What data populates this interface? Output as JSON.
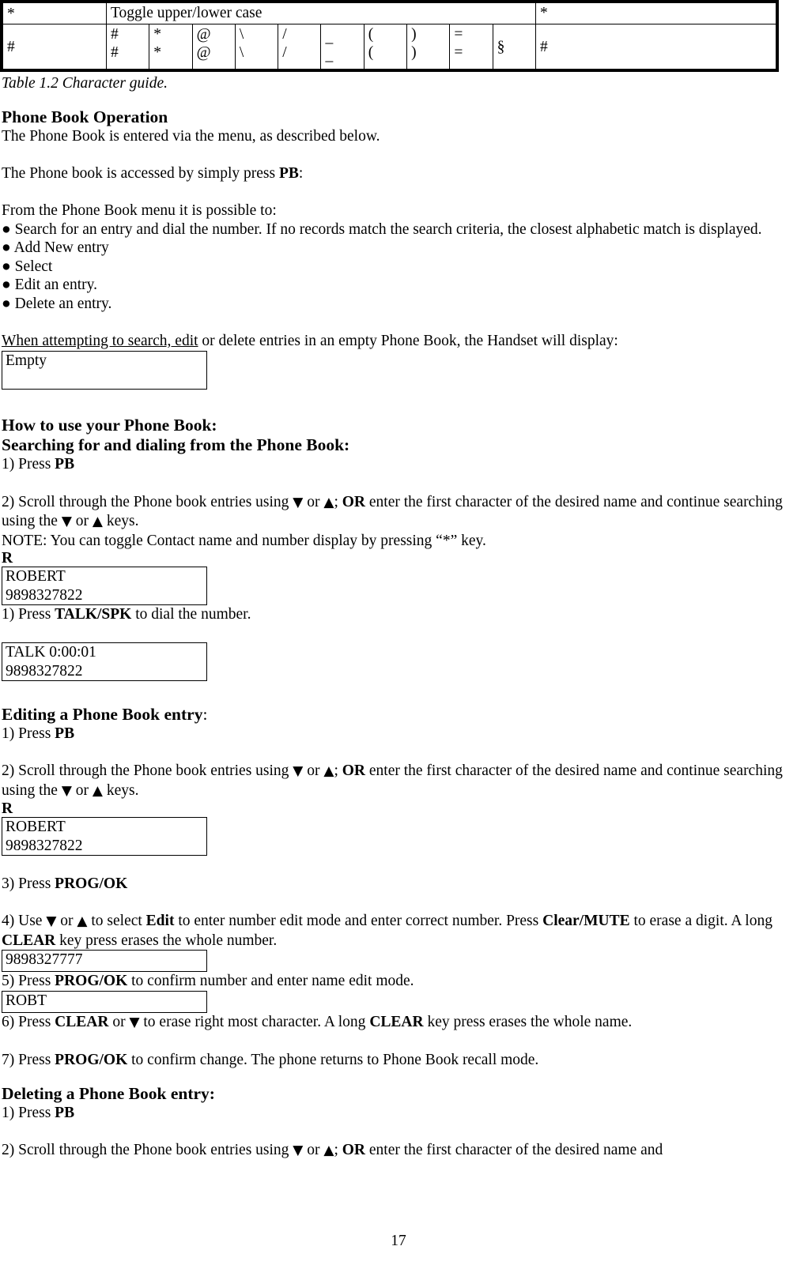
{
  "char_table": {
    "header_row": {
      "left": "*",
      "merged_label": "Toggle upper/lower case",
      "right": "*"
    },
    "body_row": {
      "left": "#",
      "cells": [
        {
          "top": "#",
          "bottom": "#"
        },
        {
          "top": "*",
          "bottom": "*"
        },
        {
          "top": "@",
          "bottom": "@"
        },
        {
          "top": "\\",
          "bottom": "\\"
        },
        {
          "top": "/",
          "bottom": "/"
        },
        {
          "top": "_",
          "bottom": "_"
        },
        {
          "top": "(",
          "bottom": "("
        },
        {
          "top": ")",
          "bottom": ")"
        },
        {
          "top": "=",
          "bottom": "="
        },
        {
          "top": "§",
          "bottom": ""
        }
      ],
      "right": "#"
    },
    "caption": "Table 1.2 Character guide."
  },
  "section_phone_book_operation": {
    "heading": "Phone Book Operation",
    "intro": "The Phone Book is entered via the menu, as described below.",
    "access_prefix": "The Phone book is accessed by simply press ",
    "access_bold": "PB",
    "access_suffix": ":",
    "menu_lead": "From the Phone Book menu it is possible to:",
    "bullets": [
      "Search for an entry and dial the number. If no records match the search criteria, the closest alphabetic match is displayed.",
      "Add New entry",
      "Select",
      "Edit an entry.",
      "Delete an entry."
    ],
    "bullet_glyph": "●",
    "empty_note_underlined": "When attempting to search, edit",
    "empty_note_rest": " or delete entries in an empty Phone Book, the Handset will display:",
    "empty_display": "Empty"
  },
  "section_how_to_use": {
    "heading": "How to use your Phone Book:",
    "subheading": "Searching for and dialing from the Phone Book:",
    "step1_prefix": "1) Press ",
    "step1_bold": "PB",
    "step2_a": "2) Scroll through the Phone book entries using ",
    "step2_down": "▼",
    "step2_b": " or ",
    "step2_up": "▲",
    "step2_c": "; ",
    "step2_or": "OR",
    "step2_d": " enter the first character of the desired name and continue searching using the ",
    "step2_e": " or ",
    "step2_f": " keys.",
    "note": "NOTE: You can toggle Contact name and number display by pressing “*” key.",
    "typed_char": "R",
    "display1_line1": "ROBERT",
    "display1_line2": "9898327822",
    "step3_prefix": "1)    Press ",
    "step3_bold": "TALK/SPK",
    "step3_suffix": " to dial the number.",
    "display2_line1": "TALK 0:00:01",
    "display2_line2": "9898327822"
  },
  "section_editing": {
    "heading_bold": "Editing a Phone Book entry",
    "heading_suffix": ":",
    "step1_prefix": "1)    Press ",
    "step1_bold": "PB",
    "step2_a": "2) Scroll through the Phone book entries using ",
    "step2_down": "▼",
    "step2_b": " or ",
    "step2_up": "▲",
    "step2_c": "; ",
    "step2_or": "OR",
    "step2_d": " enter the first character of the desired name and continue searching using the ",
    "step2_e": " or ",
    "step2_f": " keys.",
    "typed_char": "R",
    "display_line1": "ROBERT",
    "display_line2": "9898327822",
    "step3_prefix": "3)  Press ",
    "step3_bold": "PROG/OK",
    "step4_a": "4)  Use ",
    "step4_down": "▼",
    "step4_b": " or ",
    "step4_up": "▲",
    "step4_c": " to select ",
    "step4_edit": "Edit",
    "step4_d": " to enter number edit mode and enter correct number. Press ",
    "step4_clearmute": "Clear/MUTE",
    "step4_e": "  to erase a digit. A long ",
    "step4_clear": "CLEAR",
    "step4_f": " key press erases the whole number.",
    "display_number": "9898327777",
    "step5_prefix": "5) Press ",
    "step5_bold": "PROG/OK",
    "step5_suffix": " to confirm number and enter name edit mode.",
    "display_name": "ROBT",
    "step6_prefix": "6) Press ",
    "step6_clear1": "CLEAR",
    "step6_mid": " or ",
    "step6_down": "▼",
    "step6_mid2": " to erase right most character. A long ",
    "step6_clear2": "CLEAR",
    "step6_suffix": " key press erases the whole name.",
    "step7_prefix": "7) Press ",
    "step7_bold": "PROG/OK",
    "step7_suffix": " to confirm change. The phone returns to Phone Book recall mode."
  },
  "section_deleting": {
    "heading": "Deleting a Phone Book entry:",
    "step1_prefix": "1)   Press ",
    "step1_bold": "PB",
    "step2_a": "2) Scroll through the Phone book entries using ",
    "step2_down": "▼",
    "step2_b": " or ",
    "step2_up": "▲",
    "step2_c": "; ",
    "step2_or": "OR",
    "step2_d": " enter the first character of the desired name and"
  },
  "footer": {
    "page_number": "17"
  }
}
